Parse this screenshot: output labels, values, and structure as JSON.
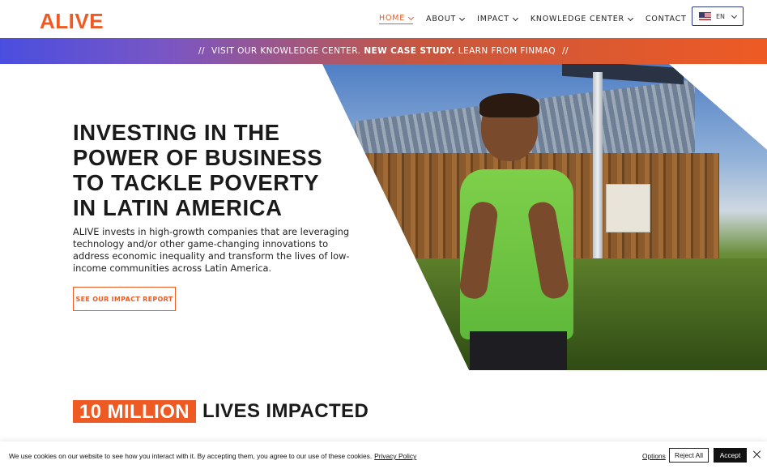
{
  "brand": {
    "logo_text": "ALIVE",
    "accent_color": "#ee5a24"
  },
  "nav": {
    "items": [
      {
        "label": "HOME",
        "active": true,
        "has_dropdown": true
      },
      {
        "label": "ABOUT",
        "has_dropdown": true
      },
      {
        "label": "IMPACT",
        "has_dropdown": true
      },
      {
        "label": "KNOWLEDGE CENTER",
        "has_dropdown": true
      },
      {
        "label": "CONTACT",
        "has_dropdown": false
      }
    ],
    "language": {
      "code": "EN",
      "flag_icon": "us-flag-icon"
    }
  },
  "banner": {
    "prefix": "//",
    "part1": "VISIT OUR KNOWLEDGE CENTER.",
    "highlight": "NEW CASE STUDY.",
    "part2": "LEARN FROM FINMAQ",
    "suffix": "//"
  },
  "hero": {
    "title": "INVESTING IN THE POWER OF BUSINESS TO TACKLE POVERTY IN LATIN AMERICA",
    "description": "ALIVE invests in high-growth companies that are leveraging technology and/or other game-changing innovations to address economic inequality and transform the lives of low-income communities across Latin America.",
    "cta_label": "SEE OUR IMPACT REPORT"
  },
  "stats": {
    "highlight": "10 MILLION",
    "rest": "LIVES IMPACTED"
  },
  "cookie": {
    "text": "We use cookies on our website to see how you interact with it. By accepting them, you agree to our use of these cookies.",
    "policy_link": "Privacy Policy",
    "options_label": "Options",
    "reject_label": "Reject All",
    "accept_label": "Accept"
  }
}
